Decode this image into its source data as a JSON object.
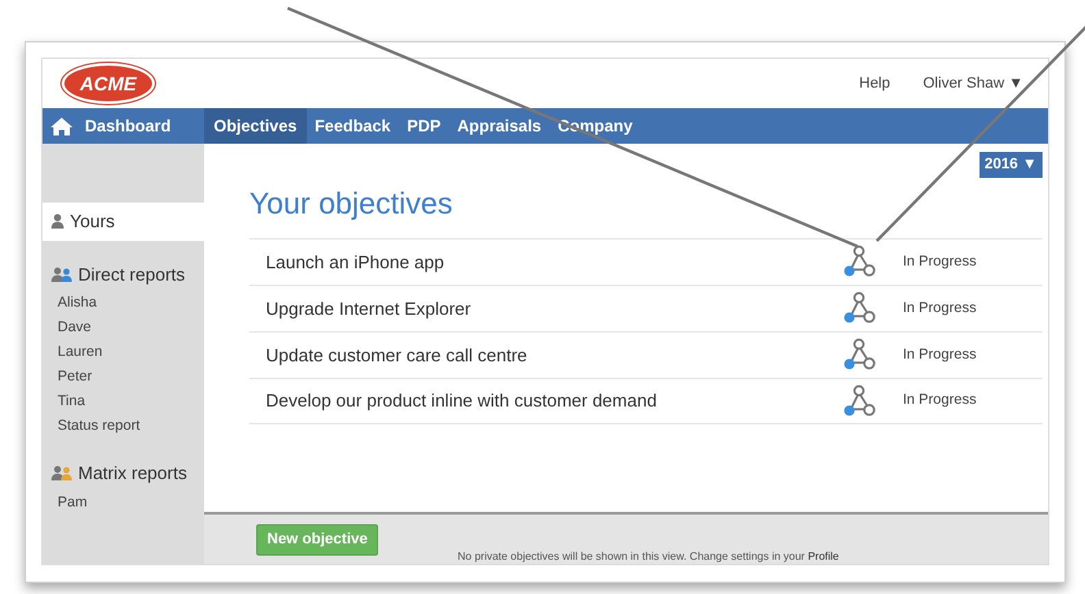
{
  "header": {
    "logo": "ACME",
    "links": [
      "Help",
      "Oliver Shaw ▼"
    ]
  },
  "nav": {
    "home": "Dashboard",
    "items": [
      {
        "label": "Objectives",
        "selected": true
      },
      {
        "label": "Feedback",
        "selected": false
      },
      {
        "label": "PDP",
        "selected": false
      },
      {
        "label": "Appraisals",
        "selected": false
      },
      {
        "label": "Company",
        "selected": false
      }
    ]
  },
  "sidebar": {
    "sections": [
      {
        "label": "Yours",
        "kind": "person",
        "selected": true
      },
      {
        "label": "Direct reports",
        "kind": "group",
        "color": "#3a87d6",
        "selected": false,
        "items": [
          "Alisha",
          "Dave",
          "Lauren",
          "Peter",
          "Tina",
          "Status report"
        ]
      },
      {
        "label": "Matrix reports",
        "kind": "group",
        "color": "#e8a53a",
        "selected": false,
        "items": [
          "Pam"
        ]
      }
    ]
  },
  "year_selector": "2016 ▼",
  "title": "Your objectives",
  "objectives": [
    {
      "title": "Launch an iPhone app",
      "status": "In Progress"
    },
    {
      "title": "Upgrade Internet Explorer",
      "status": "In Progress"
    },
    {
      "title": "Update customer care call centre",
      "status": "In Progress"
    },
    {
      "title": "Develop our product inline with customer demand",
      "status": "In Progress"
    }
  ],
  "footer": {
    "button": "New objective",
    "note": "No private objectives will be shown in this view. Change settings in your",
    "note_link": "Profile"
  }
}
